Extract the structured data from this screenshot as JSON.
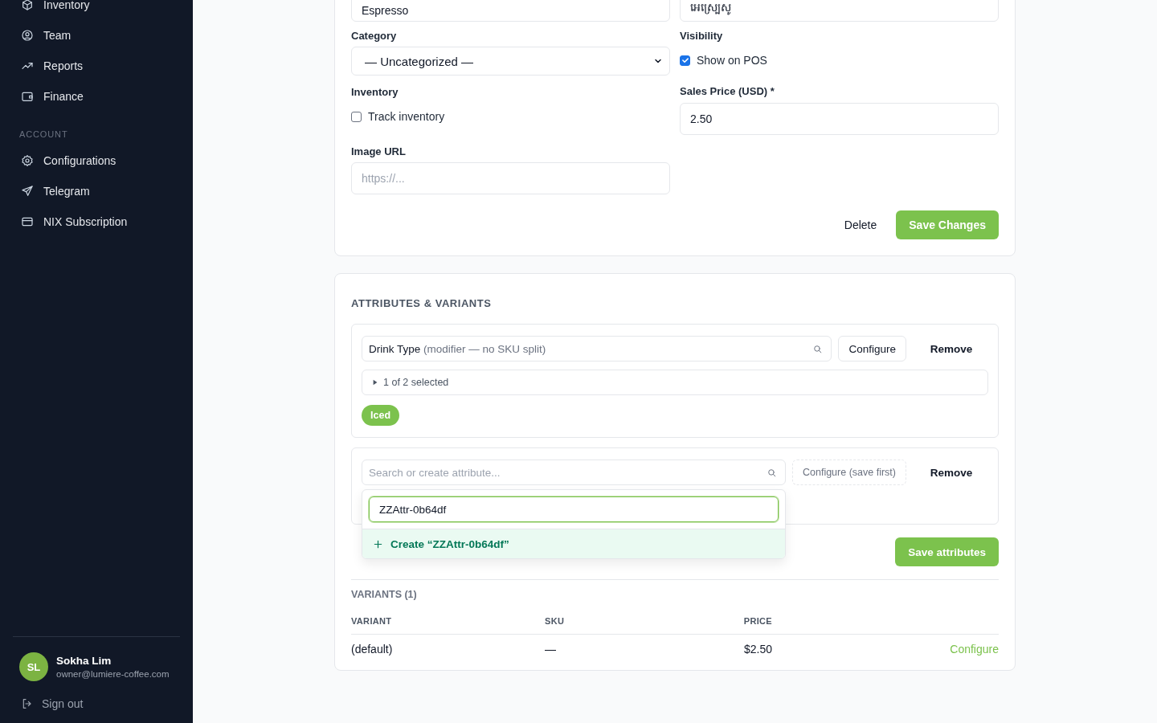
{
  "sidebar": {
    "groups": [
      {
        "items": [
          {
            "label": "Inventory"
          },
          {
            "label": "Team"
          },
          {
            "label": "Reports"
          },
          {
            "label": "Finance"
          }
        ]
      },
      {
        "heading": "ACCOUNT",
        "items": [
          {
            "label": "Configurations"
          },
          {
            "label": "Telegram"
          },
          {
            "label": "NIX Subscription"
          }
        ]
      }
    ],
    "user": {
      "initials": "SL",
      "name": "Sokha Lim",
      "email": "owner@lumiere-coffee.com"
    },
    "sign_out": "Sign out"
  },
  "product_form": {
    "name_field": {
      "value": "Espresso"
    },
    "khmer_name_field": {
      "value": "អេស្ប្រេសូ"
    },
    "category": {
      "label": "Category",
      "value": "— Uncategorized —"
    },
    "visibility": {
      "label": "Visibility",
      "option": {
        "label": "Show on POS",
        "checked": true
      }
    },
    "inventory": {
      "label": "Inventory",
      "option": {
        "label": "Track inventory",
        "checked": false
      }
    },
    "sales_price": {
      "label": "Sales Price (USD) *",
      "value": "2.50"
    },
    "image_url": {
      "label": "Image URL",
      "placeholder": "https://..."
    },
    "actions": {
      "delete": "Delete",
      "save": "Save Changes"
    }
  },
  "attributes": {
    "heading": "ATTRIBUTES & VARIANTS",
    "rows": [
      {
        "kind": "existing",
        "name": "Drink Type",
        "note": "(modifier — no SKU split)",
        "configure": {
          "label": "Configure",
          "disabled": false
        },
        "remove": "Remove",
        "summary": "1 of 2 selected",
        "expanded": false,
        "chips": [
          "Iced"
        ]
      },
      {
        "kind": "new",
        "placeholder": "Search or create attribute...",
        "configure": {
          "label": "Configure (save first)",
          "disabled": true
        },
        "remove": "Remove",
        "dropdown": {
          "query": "ZZAttr-0b64df",
          "create_option": "Create “ZZAttr-0b64df”"
        }
      }
    ],
    "save": "Save attributes"
  },
  "variants": {
    "heading": "VARIANTS (1)",
    "columns": [
      "VARIANT",
      "SKU",
      "PRICE"
    ],
    "rows": [
      {
        "variant": "(default)",
        "sku": "—",
        "price": "$2.50",
        "action": "Configure"
      }
    ]
  }
}
